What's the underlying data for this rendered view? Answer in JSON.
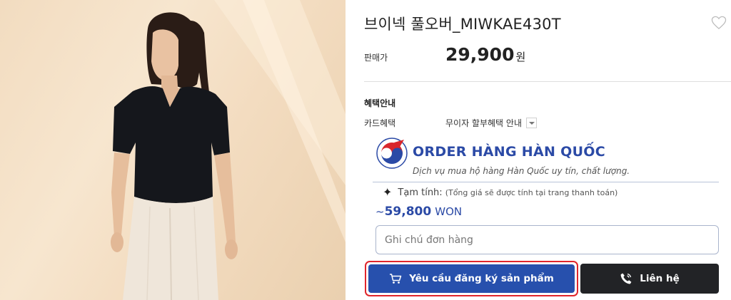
{
  "product": {
    "title": "브이넥 풀오버_MIWKAE430T",
    "price_label": "판매가",
    "price_value": "29,900",
    "price_unit": "원"
  },
  "benefits": {
    "title": "혜택안내",
    "card_label": "카드혜택",
    "card_info": "무이자 할부혜택 안내"
  },
  "order_service": {
    "brand_name": "ORDER HÀNG HÀN QUỐC",
    "tagline": "Dịch vụ mua hộ hàng Hàn Quốc uy tín, chất lượng.",
    "estimate_label": "Tạm tính:",
    "estimate_note": "(Tổng giá sẽ được tính tại trang thanh toán)",
    "total_prefix": "~",
    "total_value": "59,800",
    "total_unit": "WON",
    "note_placeholder": "Ghi chú đơn hàng",
    "request_button": "Yêu cầu đăng ký sản phẩm",
    "contact_button": "Liên hệ"
  },
  "colors": {
    "brand_blue": "#2750ad",
    "highlight_red": "#e0252b",
    "dark_button": "#222326"
  },
  "icons": [
    "heart-icon",
    "chevron-down-icon",
    "sparkle-icon",
    "cart-icon",
    "phone-icon",
    "logo-icon"
  ]
}
